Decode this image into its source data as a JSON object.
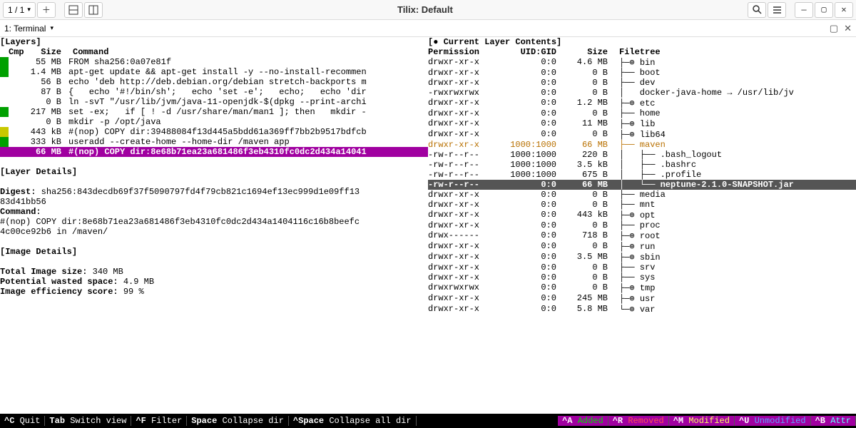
{
  "window": {
    "title": "Tilix: Default",
    "session_label": "1 / 1",
    "tab_label": "1: Terminal"
  },
  "left": {
    "layers_title": "[Layers]",
    "headers": {
      "cmp": "Cmp",
      "size": "Size",
      "command": "Command"
    },
    "rows": [
      {
        "cmp": "green",
        "size": "55 MB",
        "command": "FROM sha256:0a07e81f"
      },
      {
        "cmp": "green",
        "size": "1.4 MB",
        "command": "apt-get update && apt-get install -y --no-install-recommen"
      },
      {
        "cmp": "",
        "size": "56 B",
        "command": "echo 'deb http://deb.debian.org/debian stretch-backports m"
      },
      {
        "cmp": "",
        "size": "87 B",
        "command": "{   echo '#!/bin/sh';   echo 'set -e';   echo;   echo 'dir"
      },
      {
        "cmp": "",
        "size": "0 B",
        "command": "ln -svT \"/usr/lib/jvm/java-11-openjdk-$(dpkg --print-archi"
      },
      {
        "cmp": "green",
        "size": "217 MB",
        "command": "set -ex;   if [ ! -d /usr/share/man/man1 ]; then   mkdir -"
      },
      {
        "cmp": "",
        "size": "0 B",
        "command": "mkdir -p /opt/java"
      },
      {
        "cmp": "yellow",
        "size": "443 kB",
        "command": "#(nop) COPY dir:39488084f13d445a5bdd61a369ff7bb2b9517bdfcb"
      },
      {
        "cmp": "green",
        "size": "333 kB",
        "command": "useradd --create-home --home-dir /maven app"
      },
      {
        "cmp": "purple",
        "size": "66 MB",
        "command": "#(nop) COPY dir:8e68b71ea23a681486f3eb4310fc0dc2d434a14041",
        "selected": true
      }
    ],
    "layer_details_title": "[Layer Details]",
    "digest_label": "Digest:",
    "digest_value": "sha256:843decdb69f37f5090797fd4f79cb821c1694ef13ec999d1e09ff13",
    "digest_value2": "83d41bb56",
    "command_label": "Command:",
    "command_value1": "#(nop) COPY dir:8e68b71ea23a681486f3eb4310fc0dc2d434a1404116c16b8beefc",
    "command_value2": "4c00ce92b6 in /maven/",
    "image_details_title": "[Image Details]",
    "total_size_label": "Total Image size:",
    "total_size_value": "340 MB",
    "wasted_label": "Potential wasted space:",
    "wasted_value": "4.9 MB",
    "efficiency_label": "Image efficiency score:",
    "efficiency_value": "99 %"
  },
  "right": {
    "title": "[● Current Layer Contents]",
    "headers": {
      "perm": "Permission",
      "uidgid": "UID:GID",
      "size": "Size",
      "tree": "Filetree"
    },
    "rows": [
      {
        "perm": "drwxr-xr-x",
        "uid": "0:0",
        "size": "4.6 MB",
        "tree": "├─⊕ bin"
      },
      {
        "perm": "drwxr-xr-x",
        "uid": "0:0",
        "size": "0 B",
        "tree": "├── boot"
      },
      {
        "perm": "drwxr-xr-x",
        "uid": "0:0",
        "size": "0 B",
        "tree": "├── dev"
      },
      {
        "perm": "-rwxrwxrwx",
        "uid": "0:0",
        "size": "0 B",
        "tree": "│   docker-java-home → /usr/lib/jv"
      },
      {
        "perm": "drwxr-xr-x",
        "uid": "0:0",
        "size": "1.2 MB",
        "tree": "├─⊕ etc"
      },
      {
        "perm": "drwxr-xr-x",
        "uid": "0:0",
        "size": "0 B",
        "tree": "├── home"
      },
      {
        "perm": "drwxr-xr-x",
        "uid": "0:0",
        "size": "11 MB",
        "tree": "├─⊕ lib"
      },
      {
        "perm": "drwxr-xr-x",
        "uid": "0:0",
        "size": "0 B",
        "tree": "├─⊕ lib64"
      },
      {
        "perm": "drwxr-xr-x",
        "uid": "1000:1000",
        "size": "66 MB",
        "tree": "├── maven",
        "orange": true
      },
      {
        "perm": "-rw-r--r--",
        "uid": "1000:1000",
        "size": "220 B",
        "tree": "│   ├── .bash_logout"
      },
      {
        "perm": "-rw-r--r--",
        "uid": "1000:1000",
        "size": "3.5 kB",
        "tree": "│   ├── .bashrc"
      },
      {
        "perm": "-rw-r--r--",
        "uid": "1000:1000",
        "size": "675 B",
        "tree": "│   ├── .profile"
      },
      {
        "perm": "-rw-r--r--",
        "uid": "0:0",
        "size": "66 MB",
        "tree": "│   └── neptune-2.1.0-SNAPSHOT.jar",
        "hl": true
      },
      {
        "perm": "drwxr-xr-x",
        "uid": "0:0",
        "size": "0 B",
        "tree": "├── media"
      },
      {
        "perm": "drwxr-xr-x",
        "uid": "0:0",
        "size": "0 B",
        "tree": "├── mnt"
      },
      {
        "perm": "drwxr-xr-x",
        "uid": "0:0",
        "size": "443 kB",
        "tree": "├─⊕ opt"
      },
      {
        "perm": "drwxr-xr-x",
        "uid": "0:0",
        "size": "0 B",
        "tree": "├── proc"
      },
      {
        "perm": "drwx------",
        "uid": "0:0",
        "size": "718 B",
        "tree": "├─⊕ root"
      },
      {
        "perm": "drwxr-xr-x",
        "uid": "0:0",
        "size": "0 B",
        "tree": "├─⊕ run"
      },
      {
        "perm": "drwxr-xr-x",
        "uid": "0:0",
        "size": "3.5 MB",
        "tree": "├─⊕ sbin"
      },
      {
        "perm": "drwxr-xr-x",
        "uid": "0:0",
        "size": "0 B",
        "tree": "├── srv"
      },
      {
        "perm": "drwxr-xr-x",
        "uid": "0:0",
        "size": "0 B",
        "tree": "├── sys"
      },
      {
        "perm": "drwxrwxrwx",
        "uid": "0:0",
        "size": "0 B",
        "tree": "├─⊕ tmp"
      },
      {
        "perm": "drwxr-xr-x",
        "uid": "0:0",
        "size": "245 MB",
        "tree": "├─⊕ usr"
      },
      {
        "perm": "drwxr-xr-x",
        "uid": "0:0",
        "size": "5.8 MB",
        "tree": "└─⊕ var"
      }
    ]
  },
  "footer": {
    "items": [
      {
        "key": "^C",
        "label": "Quit"
      },
      {
        "key": "Tab",
        "label": "Switch view"
      },
      {
        "key": "^F",
        "label": "Filter"
      },
      {
        "key": "Space",
        "label": "Collapse dir"
      },
      {
        "key": "^Space",
        "label": "Collapse all dir"
      }
    ],
    "legend": [
      {
        "key": "^A",
        "label": "Added",
        "cls": "c-green"
      },
      {
        "key": "^R",
        "label": "Removed",
        "cls": "c-red"
      },
      {
        "key": "^M",
        "label": "Modified",
        "cls": "c-yellow"
      },
      {
        "key": "^U",
        "label": "Unmodified",
        "cls": "c-blue"
      },
      {
        "key": "^B",
        "label": "Attr",
        "cls": "c-cyan"
      }
    ]
  }
}
